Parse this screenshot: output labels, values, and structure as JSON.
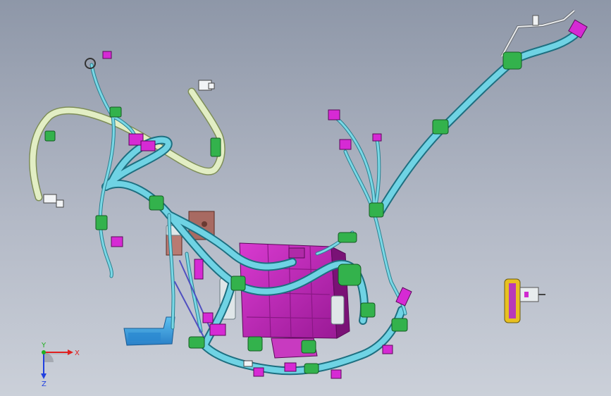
{
  "viewport": {
    "colors": {
      "background_top": "#8e97a8",
      "background_bottom": "#cbd0d9",
      "wire_main": "#5ec9db",
      "wire_light": "#d8e8b8",
      "clip_green": "#2fb04a",
      "connector_magenta": "#d02ad0",
      "ecu_housing": "#c02ab8",
      "bracket_blue": "#3aa0e0",
      "relay_brown": "#a86a62",
      "fuse_yellow": "#e8c020"
    }
  },
  "triad": {
    "x_label": "X",
    "y_label": "Y",
    "z_label": "Z",
    "colors": {
      "x": "#e02020",
      "y": "#20b020",
      "z": "#2040e0"
    }
  },
  "model": {
    "icons": {
      "harness": "wire-harness-icon",
      "ecu": "ecu-module-icon",
      "fuse": "fuse-connector-icon"
    }
  }
}
